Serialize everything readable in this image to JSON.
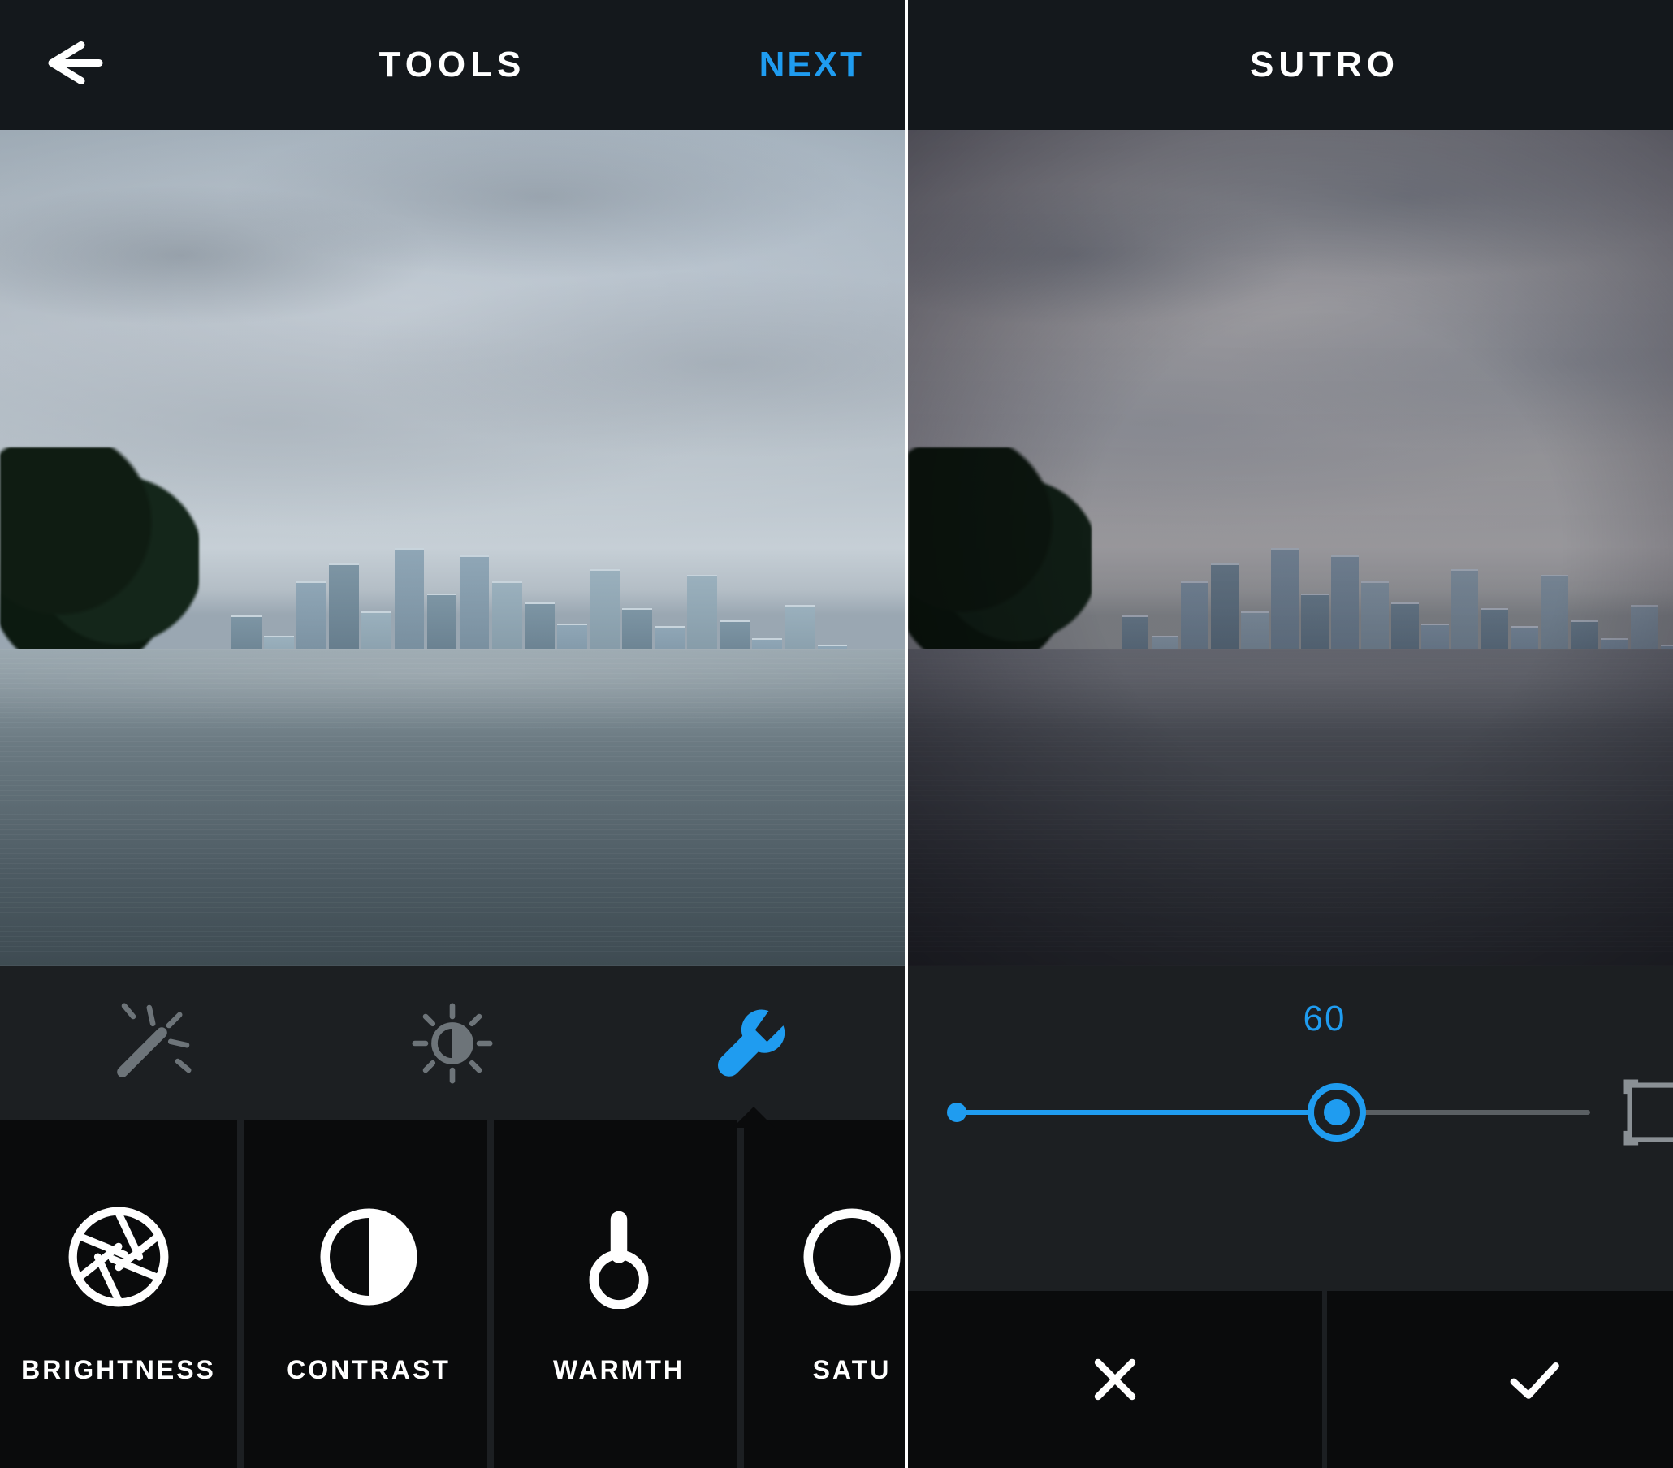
{
  "accent_color": "#1f9cf0",
  "left": {
    "header": {
      "title": "TOOLS",
      "next_label": "NEXT"
    },
    "tabs": {
      "items": [
        {
          "name": "auto-enhance",
          "active": false
        },
        {
          "name": "lux",
          "active": false
        },
        {
          "name": "tools",
          "active": true
        }
      ],
      "active_index": 2
    },
    "tools": [
      {
        "name": "brightness",
        "label": "BRIGHTNESS"
      },
      {
        "name": "contrast",
        "label": "CONTRAST"
      },
      {
        "name": "warmth",
        "label": "WARMTH"
      },
      {
        "name": "saturation",
        "label": "SATU"
      }
    ]
  },
  "right": {
    "header": {
      "title": "SUTRO"
    },
    "filter_name": "Sutro",
    "slider": {
      "value": 60,
      "min": 0,
      "max": 100,
      "value_display": "60"
    },
    "frame_enabled": false
  }
}
